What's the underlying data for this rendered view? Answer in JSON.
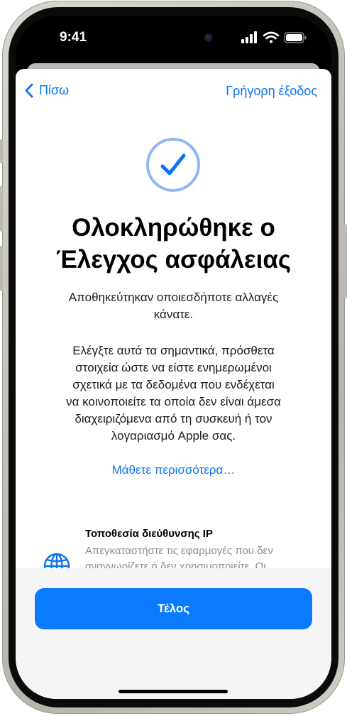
{
  "status_bar": {
    "time": "9:41",
    "icons": [
      "signal-icon",
      "wifi-icon",
      "battery-icon"
    ]
  },
  "nav": {
    "back_label": "Πίσω",
    "quick_exit_label": "Γρήγορη έξοδος"
  },
  "content": {
    "status_icon": "checkmark-circle-icon",
    "title_line1": "Ολοκληρώθηκε ο",
    "title_line2": "Έλεγχος ασφάλειας",
    "paragraph1_line1": "Αποθηκεύτηκαν οποιεσδήποτε αλλαγές",
    "paragraph1_line2": "κάνατε.",
    "paragraph2_lines": [
      "Ελέγξτε αυτά τα σημαντικά, πρόσθετα",
      "στοιχεία ώστε να είστε ενημερωμένοι",
      "σχετικά με τα δεδομένα που ενδέχεται",
      "να κοινοποιείτε τα οποία δεν είναι άμεσα",
      "διαχειριζόμενα από τη συσκευή ή τον",
      "λογαριασμό Apple σας."
    ],
    "learn_more": "Μάθετε περισσότερα…"
  },
  "list_item": {
    "icon": "globe-icon",
    "title": "Τοποθεσία διεύθυνσης IP",
    "description_line1": "Απεγκαταστήστε τις εφαρμογές που δεν",
    "description_line2": "αναγνωρίζετε ή δεν χρησιμοποιείτε. Οι"
  },
  "footer": {
    "done_label": "Τέλος"
  },
  "colors": {
    "accent": "#0a74f4",
    "button": "#0a7bff",
    "check_ring": "#8fb9f3",
    "check_mark": "#0a74f4",
    "secondary_text": "#8e8e93"
  }
}
